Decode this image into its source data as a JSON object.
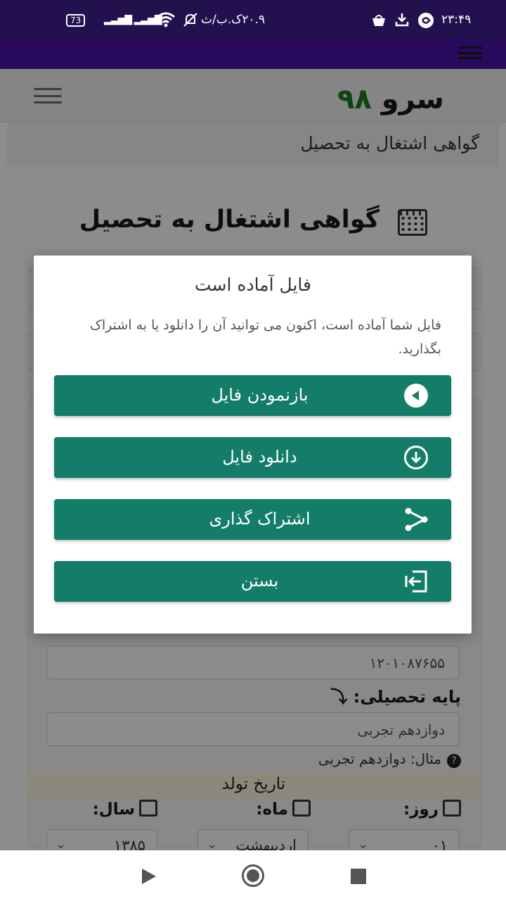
{
  "status_bar": {
    "time": "۲۳:۴۹",
    "network_speed": "۲۰.۹ک.ب/ث",
    "battery": "73"
  },
  "header": {
    "logo_text": "سرو",
    "logo_number": "۹۸"
  },
  "breadcrumb": "گواهی اشتغال به تحصیل",
  "page": {
    "title": "گواهی اشتغال به تحصیل",
    "national_code_value": "۱۲۰۱۰۸۷۶۵۵",
    "grade_label": "پایه تحصیلی:",
    "grade_value": "دوازدهم تجربی",
    "grade_hint": "مثال: دوازدهم تجربی",
    "birth_date_heading": "تاریخ تولد",
    "day_label": "روز:",
    "month_label": "ماه:",
    "year_label": "سال:",
    "day_value": "۰۱",
    "month_value": "اردیبهشت",
    "year_value": "۱۳۸۵"
  },
  "modal": {
    "title": "فایل آماده است",
    "message": "فایل شما آماده است، اکنون می توانید آن را دانلود یا به اشتراک بگذارید.",
    "buttons": {
      "open": "بازنمودن فایل",
      "download": "دانلود فایل",
      "share": "اشتراک گذاری",
      "close": "بستن"
    }
  },
  "colors": {
    "status_bar": "#22104f",
    "app_bar": "#4a12a6",
    "modal_button": "#137d6a",
    "logo_number": "#1f7a1f"
  },
  "icons": [
    "battery-icon",
    "signal-icon",
    "wifi-icon",
    "mute-icon",
    "download-icon",
    "play-icon",
    "share-icon",
    "exit-icon",
    "calculator-icon",
    "calendar-icon"
  ]
}
